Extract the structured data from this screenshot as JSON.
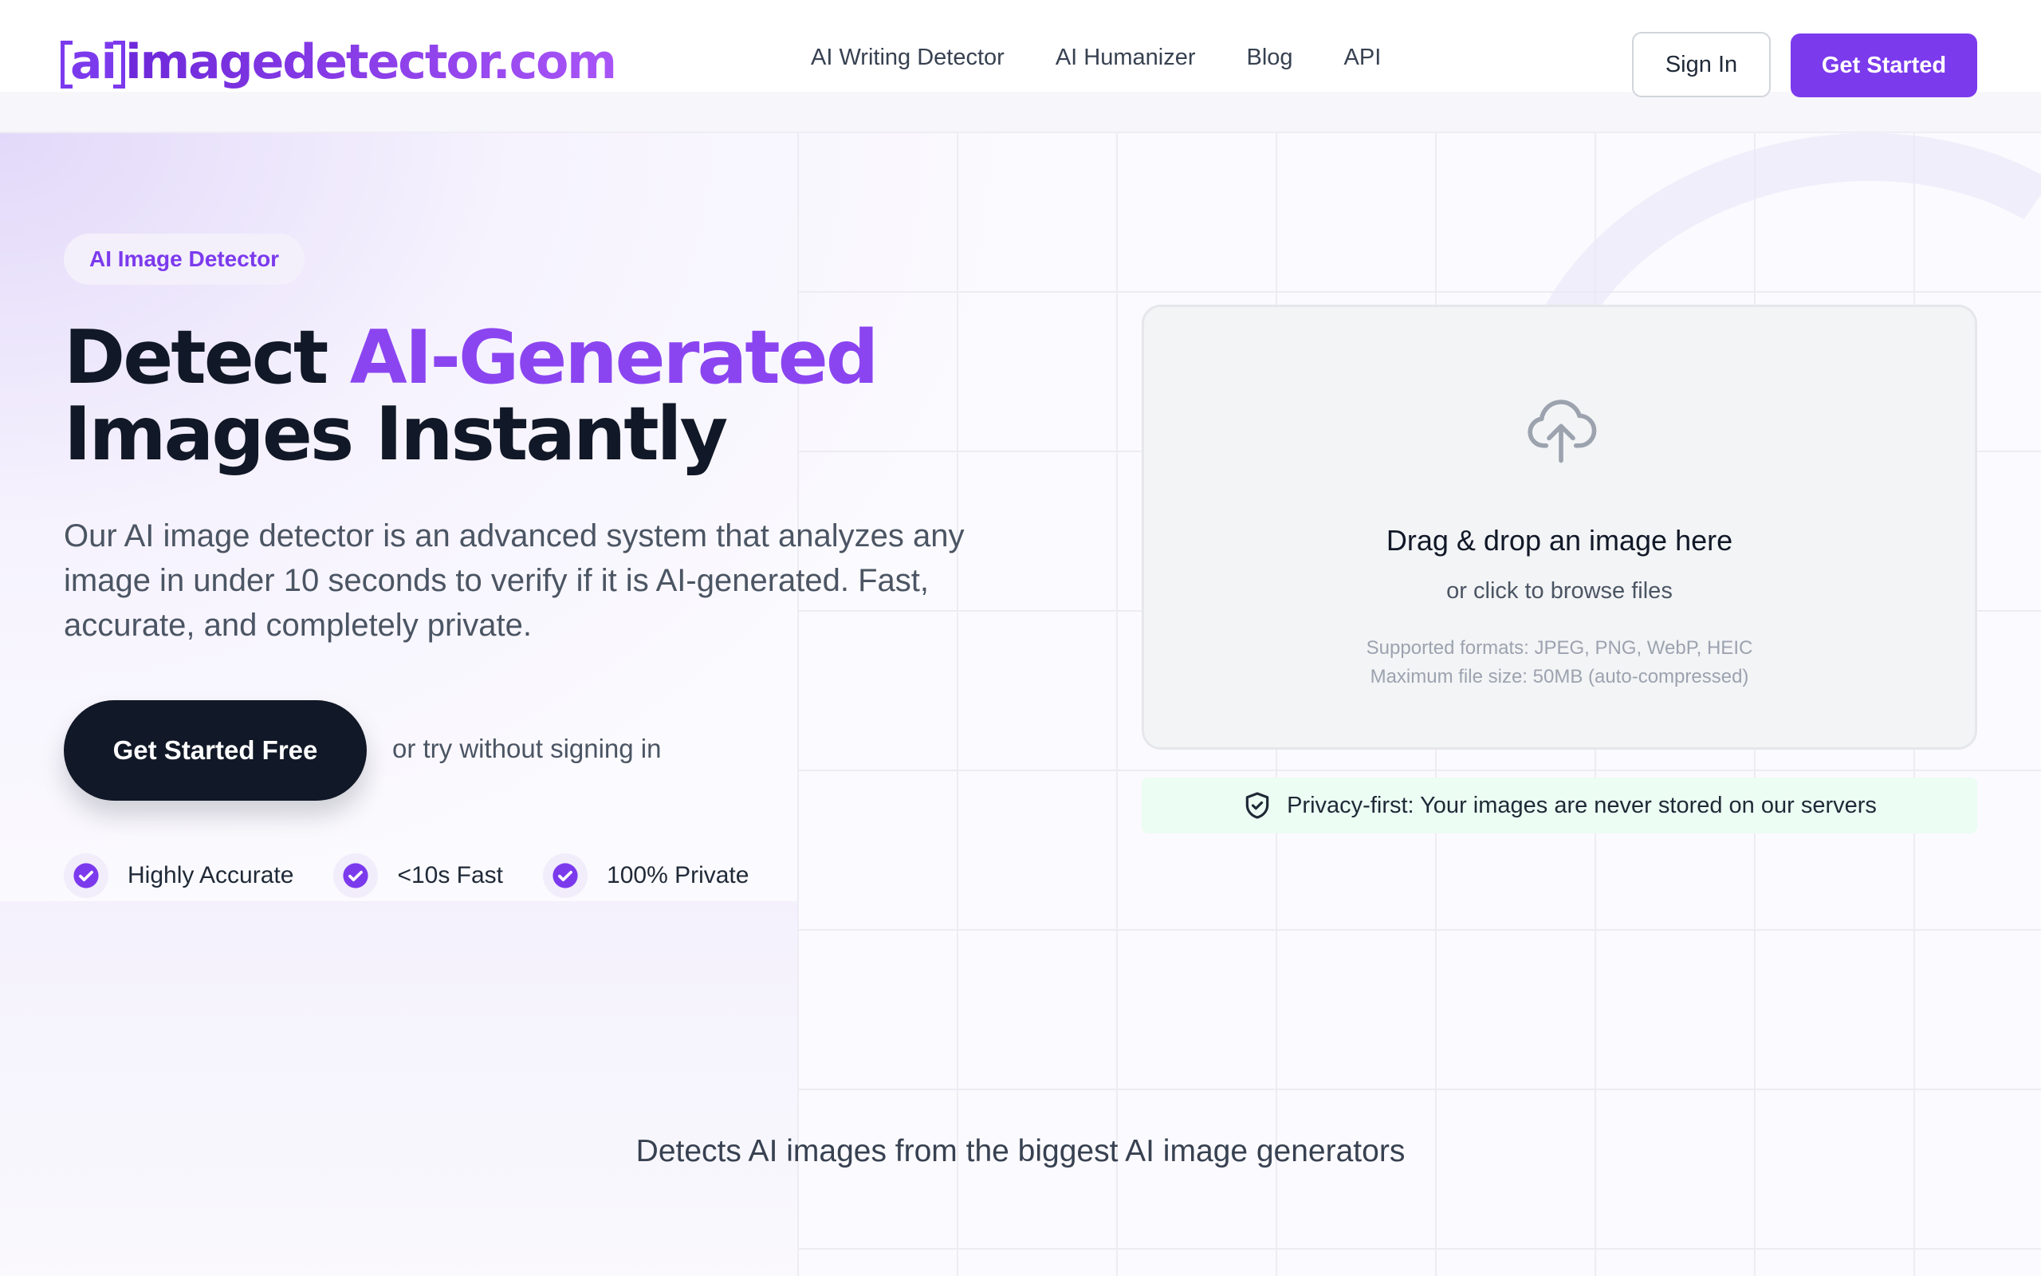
{
  "header": {
    "logo_ai": "ai",
    "logo_rest": "imagedetector.com",
    "nav": [
      "AI Writing Detector",
      "AI Humanizer",
      "Blog",
      "API"
    ],
    "sign_in": "Sign In",
    "get_started": "Get Started"
  },
  "hero": {
    "pill": "AI Image Detector",
    "headline_1": "Detect ",
    "headline_accent": "AI-Generated",
    "headline_2": "Images Instantly",
    "lead": "Our AI image detector is an advanced system that analyzes any image in under 10 seconds to verify if it is AI-generated. Fast, accurate, and completely private.",
    "cta": "Get Started Free",
    "try_text": "or try without signing in",
    "features": [
      "Highly Accurate",
      "<10s Fast",
      "100% Private"
    ]
  },
  "upload": {
    "title": "Drag & drop an image here",
    "subtitle": "or click to browse files",
    "formats": "Supported formats: JPEG, PNG, WebP, HEIC",
    "max_size": "Maximum file size: 50MB (auto-compressed)"
  },
  "privacy": {
    "text": "Privacy-first: Your images are never stored on our servers"
  },
  "generators": {
    "heading": "Detects AI images from the biggest AI image generators"
  },
  "colors": {
    "brand": "#7c3aed",
    "dark": "#111827",
    "privacy_bg": "#ecfdf3"
  }
}
